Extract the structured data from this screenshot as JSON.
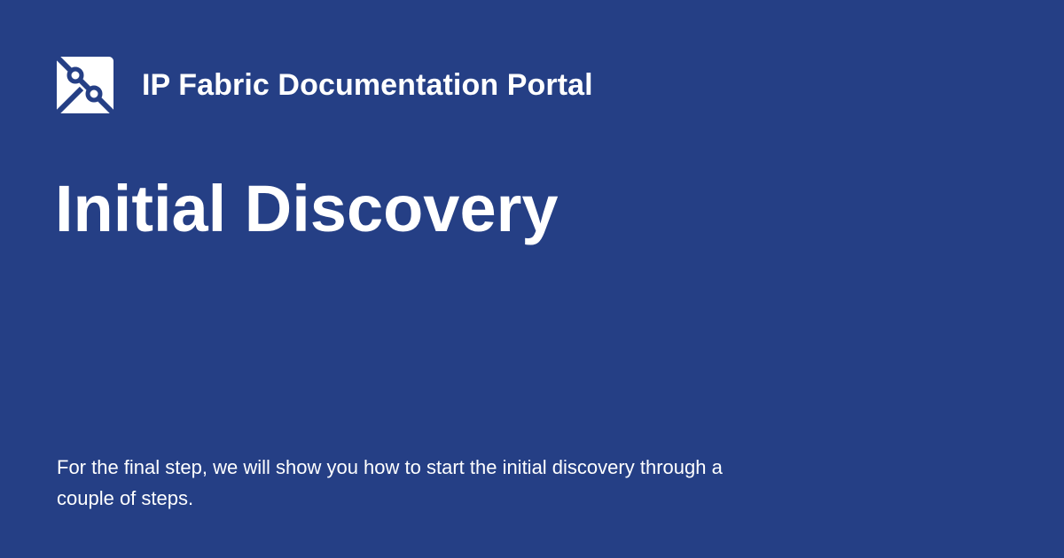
{
  "header": {
    "logo_icon": "ip-fabric-logo-icon",
    "site_name": "IP Fabric Documentation Portal"
  },
  "page": {
    "title": "Initial Discovery",
    "description": "For the final step, we will show you how to start the initial discovery through a couple of steps."
  },
  "colors": {
    "background": "#253f85",
    "text": "#ffffff"
  }
}
